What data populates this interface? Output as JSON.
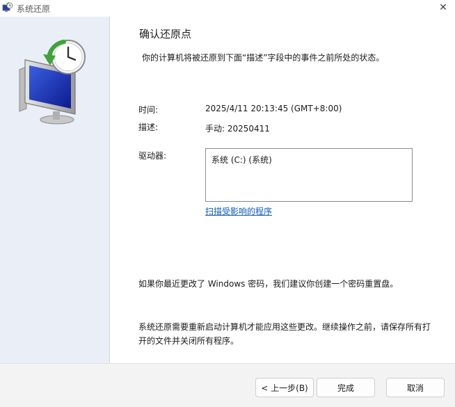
{
  "window": {
    "title": "系统还原",
    "close_glyph": "✕"
  },
  "main": {
    "heading": "确认还原点",
    "description": "你的计算机将被还原到下面“描述”字段中的事件之前所处的状态。",
    "time_label": "时间:",
    "time_value": "2025/4/11 20:13:45 (GMT+8:00)",
    "desc_label": "描述:",
    "desc_value": "手动: 20250411",
    "drives_label": "驱动器:",
    "drives": [
      "系统 (C:) (系统)"
    ],
    "scan_link": "扫描受影响的程序",
    "password_note": "如果你最近更改了 Windows 密码，我们建议你创建一个密码重置盘。",
    "restart_note": "系统还原需要重新启动计算机才能应用这些更改。继续操作之前，请保存所有打开的文件并关闭所有程序。"
  },
  "footer": {
    "back_label": "< 上一步(B)",
    "finish_label": "完成",
    "cancel_label": "取消"
  },
  "icons": {
    "app": "system-restore-icon",
    "side_art": "system-restore-monitor-clock-icon",
    "close": "close-icon"
  },
  "colors": {
    "side_panel": "#e9eef7",
    "link": "#0b5bbd",
    "footer": "#f3f3f3"
  }
}
